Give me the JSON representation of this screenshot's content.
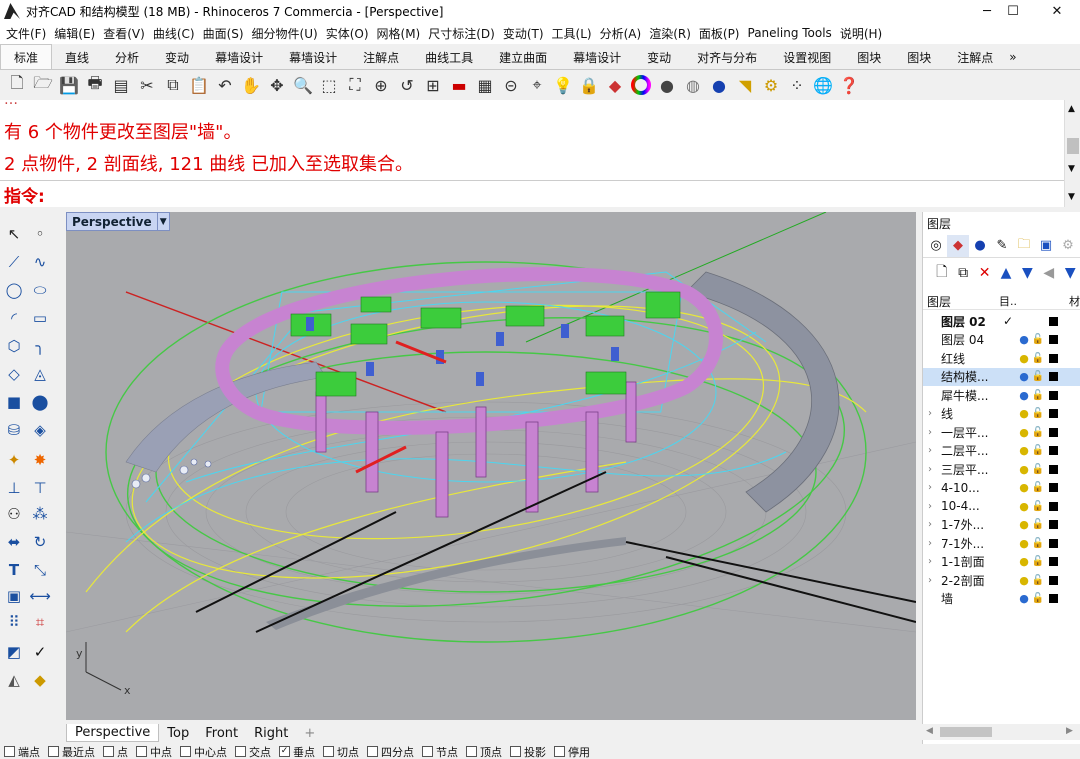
{
  "window": {
    "title": "对齐CAD 和结构模型 (18 MB) - Rhinoceros 7 Commercia - [Perspective]",
    "minimize": "─",
    "maximize": "☐",
    "close": "✕"
  },
  "menu": [
    "文件(F)",
    "编辑(E)",
    "查看(V)",
    "曲线(C)",
    "曲面(S)",
    "细分物件(U)",
    "实体(O)",
    "网格(M)",
    "尺寸标注(D)",
    "变动(T)",
    "工具(L)",
    "分析(A)",
    "渲染(R)",
    "面板(P)",
    "Paneling Tools",
    "说明(H)"
  ],
  "tabs": [
    "标准",
    "直线",
    "分析",
    "变动",
    "幕墙设计",
    "幕墙设计",
    "注解点",
    "曲线工具",
    "建立曲面",
    "幕墙设计",
    "变动",
    "对齐与分布",
    "设置视图",
    "图块",
    "图块",
    "注解点"
  ],
  "tabs_more": "»",
  "toolbar_icons": [
    "new-icon",
    "open-icon",
    "save-icon",
    "print-icon",
    "import-icon",
    "cut-icon",
    "copy-icon",
    "paste-icon",
    "undo-icon",
    "pan-icon",
    "rotate-view-icon",
    "zoom-icon",
    "zoom-window-icon",
    "zoom-extents-icon",
    "zoom-selected-icon",
    "undo-view-icon",
    "viewport-layout-icon",
    "car-icon",
    "grid-icon",
    "cplane-icon",
    "snap-icon",
    "light-icon",
    "lock-icon",
    "layer-icon",
    "color-wheel-icon",
    "sphere-icon",
    "material-icon",
    "render-icon",
    "filter-icon",
    "gear-icon",
    "options-icon",
    "globe-icon",
    "help-icon"
  ],
  "command": {
    "line0": "…",
    "line1": "有 6 个物件更改至图层\"墙\"。",
    "line2": "2 点物件, 2 剖面线, 121 曲线 已加入至选取集合。",
    "prompt": "指令:"
  },
  "viewport": {
    "label": "Perspective",
    "axis_x": "x",
    "axis_y": "y"
  },
  "view_tabs": [
    "Perspective",
    "Top",
    "Front",
    "Right"
  ],
  "view_tabs_add": "+",
  "panel": {
    "title": "图层",
    "col_name": "图层",
    "col_current": "目..",
    "col_material": "材",
    "layers": [
      {
        "name": "图层 02",
        "current": "✓",
        "bold": true,
        "sub": false
      },
      {
        "name": "图层 04",
        "current": "",
        "sub": false
      },
      {
        "name": "红线",
        "current": "",
        "sub": false
      },
      {
        "name": "结构模...",
        "current": "",
        "sub": false,
        "selected": true
      },
      {
        "name": "犀牛模...",
        "current": "",
        "sub": false
      },
      {
        "name": "线",
        "current": "",
        "sub": true
      },
      {
        "name": "一层平...",
        "current": "",
        "sub": true
      },
      {
        "name": "二层平...",
        "current": "",
        "sub": true
      },
      {
        "name": "三层平...",
        "current": "",
        "sub": true
      },
      {
        "name": "4-10...",
        "current": "",
        "sub": true
      },
      {
        "name": "10-4...",
        "current": "",
        "sub": true
      },
      {
        "name": "1-7外...",
        "current": "",
        "sub": true
      },
      {
        "name": "7-1外...",
        "current": "",
        "sub": true
      },
      {
        "name": "1-1剖面",
        "current": "",
        "sub": true
      },
      {
        "name": "2-2剖面",
        "current": "",
        "sub": true
      },
      {
        "name": "墙",
        "current": "",
        "sub": false
      }
    ]
  },
  "status_snaps": [
    {
      "label": "端点",
      "checked": false
    },
    {
      "label": "最近点",
      "checked": false
    },
    {
      "label": "点",
      "checked": false
    },
    {
      "label": "中点",
      "checked": false
    },
    {
      "label": "中心点",
      "checked": false
    },
    {
      "label": "交点",
      "checked": false
    },
    {
      "label": "垂点",
      "checked": true
    },
    {
      "label": "切点",
      "checked": false
    },
    {
      "label": "四分点",
      "checked": false
    },
    {
      "label": "节点",
      "checked": false
    },
    {
      "label": "顶点",
      "checked": false
    },
    {
      "label": "投影",
      "checked": false
    },
    {
      "label": "停用",
      "checked": false
    }
  ],
  "colors": {
    "command_text": "#e00000",
    "viewport_bg": "#a9aaad",
    "selected_row": "#cce0f7"
  }
}
